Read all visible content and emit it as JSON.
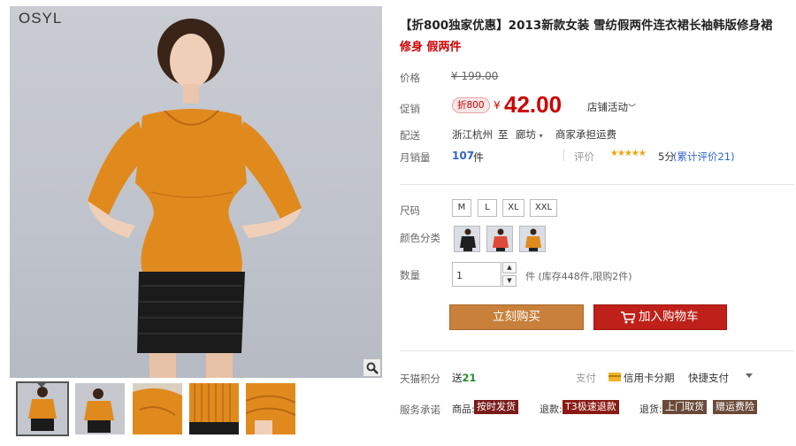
{
  "gallery": {
    "brand": "OSYL",
    "thumb_count": 5
  },
  "product": {
    "title": "【折800独家优惠】2013新款女装 雪纺假两件连衣裙长袖韩版修身裙",
    "subtitle": "修身 假两件"
  },
  "price": {
    "original_label": "价格",
    "original_value": "¥ 199.00",
    "promo_label": "促销",
    "promo_badge": "折800",
    "currency": "¥",
    "promo_value": "42.00",
    "store_activity": "店铺活动"
  },
  "shipping": {
    "label": "配送",
    "from": "浙江杭州",
    "to_word": "至",
    "to": "廊坊",
    "fee": "商家承担运费"
  },
  "sales": {
    "label": "月销量",
    "count": "107",
    "unit": "件",
    "rating_label": "评价",
    "stars": "★★★★★",
    "score": "5分",
    "reviews": "(累计评价21)"
  },
  "size": {
    "label": "尺码",
    "options": [
      "M",
      "L",
      "XL",
      "XXL"
    ]
  },
  "color": {
    "label": "颜色分类"
  },
  "quantity": {
    "label": "数量",
    "value": "1",
    "up": "▲",
    "down": "▼",
    "stock": "件 (库存448件,限购2件)"
  },
  "actions": {
    "buy_now": "立刻购买",
    "add_cart": "加入购物车"
  },
  "points": {
    "label": "天猫积分",
    "text": "送",
    "value": "21"
  },
  "payment": {
    "label": "支付",
    "card": "信用卡分期",
    "quick": "快捷支付"
  },
  "service": {
    "label": "服务承诺",
    "ship_prefix": "商品:",
    "ship_tag": "按时发货",
    "return_prefix": "退款:",
    "return_tag": "T3极速退款",
    "goods_prefix": "退货:",
    "goods_tag": "上门取货",
    "insurance_tag": "赠运费险"
  },
  "colors": {
    "price_red": "#cc0000",
    "buy_button": "#c8803b",
    "cart_button": "#c0201a",
    "link_blue": "#3366cc",
    "star_orange": "#f5a00c",
    "blouse_orange": "#e08a1e"
  }
}
